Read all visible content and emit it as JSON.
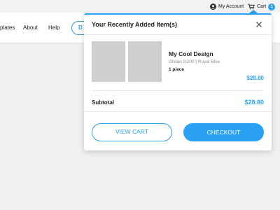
{
  "topbar": {
    "account_label": "My Account",
    "cart_label": "Cart",
    "cart_count": "1"
  },
  "nav": {
    "links": [
      "plates",
      "About",
      "Help"
    ],
    "cta_label": "D"
  },
  "dropdown": {
    "title": "Your Recently Added Item(s)",
    "item": {
      "name": "My Cool Design",
      "variant": "Gildan G200 | Royal Blue",
      "quantity": "1 piece",
      "price": "$28.80"
    },
    "subtotal_label": "Subtotal",
    "subtotal_value": "$28.80",
    "view_cart_label": "VIEW CART",
    "checkout_label": "CHECKOUT"
  },
  "colors": {
    "accent": "#2aa1f2",
    "thumb_placeholder": "#cfcfcf"
  },
  "icons": {
    "account": "user-circle-icon",
    "cart": "cart-icon",
    "close": "close-icon"
  }
}
